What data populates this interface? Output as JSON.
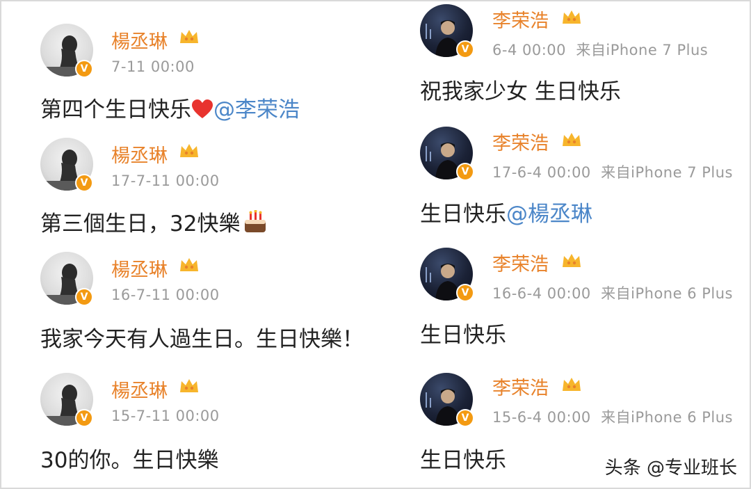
{
  "left_posts": [
    {
      "user": "楊丞琳",
      "time": "7-11 00:00",
      "text": "第四个生日快乐",
      "emoji": "heart",
      "mention": "@李荣浩"
    },
    {
      "user": "楊丞琳",
      "time": "17-7-11 00:00",
      "text": "第三個生日，32快樂",
      "emoji": "cake",
      "mention": ""
    },
    {
      "user": "楊丞琳",
      "time": "16-7-11 00:00",
      "text": "我家今天有人過生日。生日快樂！",
      "emoji": "",
      "mention": ""
    },
    {
      "user": "楊丞琳",
      "time": "15-7-11 00:00",
      "text": "30的你。生日快樂",
      "emoji": "",
      "mention": ""
    }
  ],
  "right_posts": [
    {
      "user": "李荣浩",
      "time": "6-4 00:00",
      "source": "来自iPhone 7 Plus",
      "text": "祝我家少女 生日快乐",
      "mention": ""
    },
    {
      "user": "李荣浩",
      "time": "17-6-4 00:00",
      "source": "来自iPhone 7 Plus",
      "text": "生日快乐",
      "mention": "@楊丞琳"
    },
    {
      "user": "李荣浩",
      "time": "16-6-4 00:00",
      "source": "来自iPhone 6 Plus",
      "text": "生日快乐",
      "mention": ""
    },
    {
      "user": "李荣浩",
      "time": "15-6-4 00:00",
      "source": "来自iPhone 6 Plus",
      "text": "生日快乐",
      "mention": ""
    }
  ],
  "watermark": "头条 @专业班长",
  "badge_letter": "V",
  "colors": {
    "username": "#e8822a",
    "mention": "#4b86c8",
    "meta": "#9a9a9a",
    "badge": "#f39a12"
  }
}
